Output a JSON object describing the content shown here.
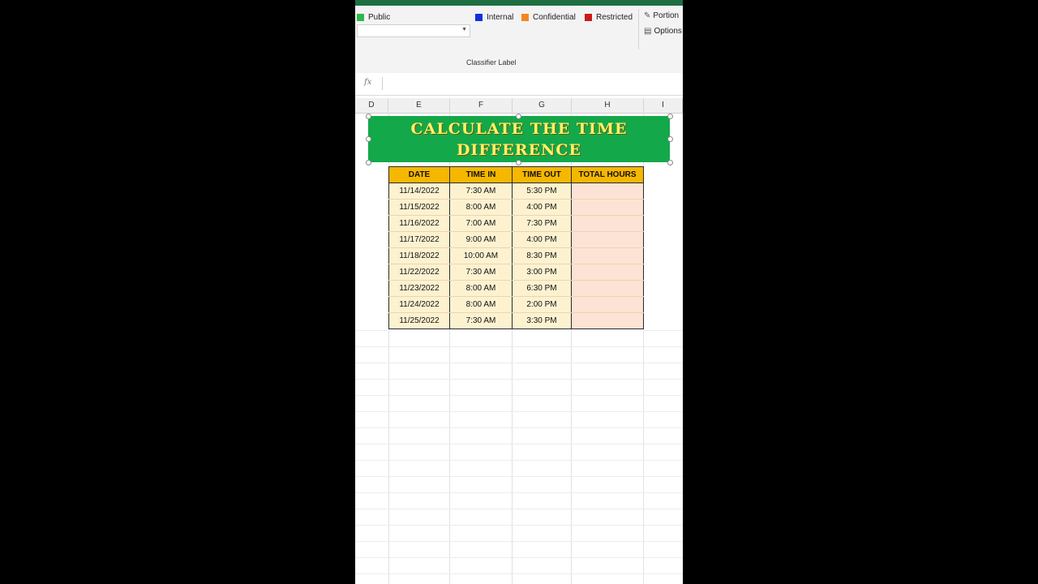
{
  "ribbon": {
    "labels": [
      {
        "text": "Public",
        "color": "#2db84a"
      },
      {
        "text": "Internal",
        "color": "#1030e0"
      },
      {
        "text": "Confidential",
        "color": "#f5861f"
      },
      {
        "text": "Restricted",
        "color": "#cc1a1a"
      }
    ],
    "portion_label": "Portion",
    "options_label": "Options",
    "group_label": "Classifier Label",
    "dropdown_value": ""
  },
  "formula_bar": {
    "fx": "fx",
    "value": ""
  },
  "columns": [
    "D",
    "E",
    "F",
    "G",
    "H",
    "I"
  ],
  "banner": {
    "line1": "CALCULATE THE TIME",
    "line2": "DIFFERENCE"
  },
  "table": {
    "headers": [
      "DATE",
      "TIME IN",
      "TIME OUT",
      "TOTAL HOURS"
    ],
    "rows": [
      [
        "11/14/2022",
        "7:30 AM",
        "5:30 PM",
        ""
      ],
      [
        "11/15/2022",
        "8:00 AM",
        "4:00 PM",
        ""
      ],
      [
        "11/16/2022",
        "7:00 AM",
        "7:30 PM",
        ""
      ],
      [
        "11/17/2022",
        "9:00 AM",
        "4:00 PM",
        ""
      ],
      [
        "11/18/2022",
        "10:00 AM",
        "8:30 PM",
        ""
      ],
      [
        "11/22/2022",
        "7:30 AM",
        "3:00 PM",
        ""
      ],
      [
        "11/23/2022",
        "8:00 AM",
        "6:30 PM",
        ""
      ],
      [
        "11/24/2022",
        "8:00 AM",
        "2:00 PM",
        ""
      ],
      [
        "11/25/2022",
        "7:30 AM",
        "3:30 PM",
        ""
      ]
    ]
  },
  "colors": {
    "header_fill": "#f5b700",
    "date_fill": "#fdf2d0",
    "total_fill": "#fde3d6",
    "banner_fill": "#13a84a",
    "banner_text": "#fff06a"
  }
}
